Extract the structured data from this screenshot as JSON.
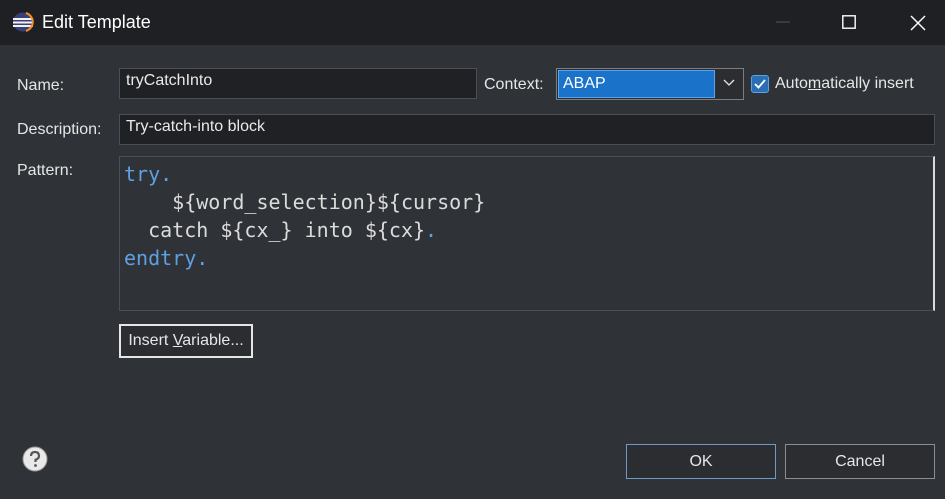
{
  "window": {
    "title": "Edit Template"
  },
  "form": {
    "name_label": "Name:",
    "name_value": "tryCatchInto",
    "context_label": "Context:",
    "context_value": "ABAP",
    "auto_insert_label_pre": "Auto",
    "auto_insert_label_mnemonic": "m",
    "auto_insert_label_post": "atically insert",
    "auto_insert_checked": true,
    "description_label": "Description:",
    "description_value": "Try-catch-into block",
    "pattern_label": "Pattern:",
    "pattern_lines": [
      {
        "a": "try.",
        "b": ""
      },
      {
        "a": "",
        "b": "    ${word_selection}${cursor}"
      },
      {
        "a": "",
        "b": "  catch ${cx_} into ${cx}",
        "c": "."
      },
      {
        "a": "endtry.",
        "b": ""
      }
    ]
  },
  "buttons": {
    "insert_variable_pre": "Insert ",
    "insert_variable_mnemonic": "V",
    "insert_variable_post": "ariable...",
    "ok": "OK",
    "cancel": "Cancel"
  },
  "icons": {
    "app": "eclipse-icon",
    "help": "help-icon"
  },
  "colors": {
    "accent": "#1a72c9",
    "keyword": "#5ea0e0",
    "background": "#2f3237",
    "titlebar": "#1f2023"
  }
}
